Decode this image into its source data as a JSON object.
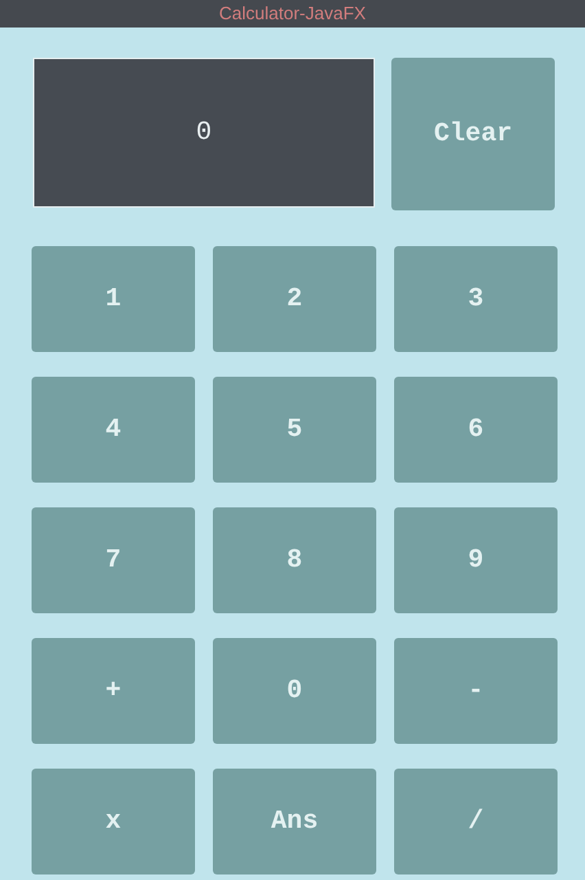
{
  "window": {
    "title": "Calculator-JavaFX"
  },
  "display": {
    "value": "0"
  },
  "clear_button": {
    "label": "Clear"
  },
  "keys": [
    [
      "1",
      "2",
      "3"
    ],
    [
      "4",
      "5",
      "6"
    ],
    [
      "7",
      "8",
      "9"
    ],
    [
      "+",
      "0",
      "-"
    ],
    [
      "x",
      "Ans",
      "/"
    ]
  ]
}
